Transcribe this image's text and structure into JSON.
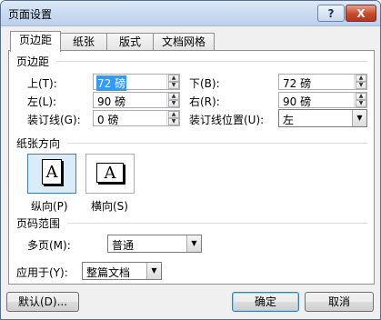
{
  "window": {
    "title": "页面设置",
    "help_glyph": "?",
    "close_glyph": "X"
  },
  "tabs": [
    {
      "label": "页边距"
    },
    {
      "label": "纸张"
    },
    {
      "label": "版式"
    },
    {
      "label": "文档网格"
    }
  ],
  "margins": {
    "section_title": "页边距",
    "top": {
      "label": "上(T):",
      "value": "72 磅"
    },
    "bottom": {
      "label": "下(B):",
      "value": "72 磅"
    },
    "left": {
      "label": "左(L):",
      "value": "90 磅"
    },
    "right": {
      "label": "右(R):",
      "value": "90 磅"
    },
    "gutter": {
      "label": "装订线(G):",
      "value": "0 磅"
    },
    "gutter_pos": {
      "label": "装订线位置(U):",
      "value": "左"
    }
  },
  "orientation": {
    "section_title": "纸张方向",
    "portrait": {
      "label": "纵向(P)",
      "glyph": "A"
    },
    "landscape": {
      "label": "横向(S)",
      "glyph": "A"
    }
  },
  "pages": {
    "section_title": "页码范围",
    "multiple_label": "多页(M):",
    "multiple_value": "普通"
  },
  "apply": {
    "label": "应用于(Y):",
    "value": "整篇文档"
  },
  "buttons": {
    "default": "默认(D)...",
    "ok": "确定",
    "cancel": "取消"
  }
}
